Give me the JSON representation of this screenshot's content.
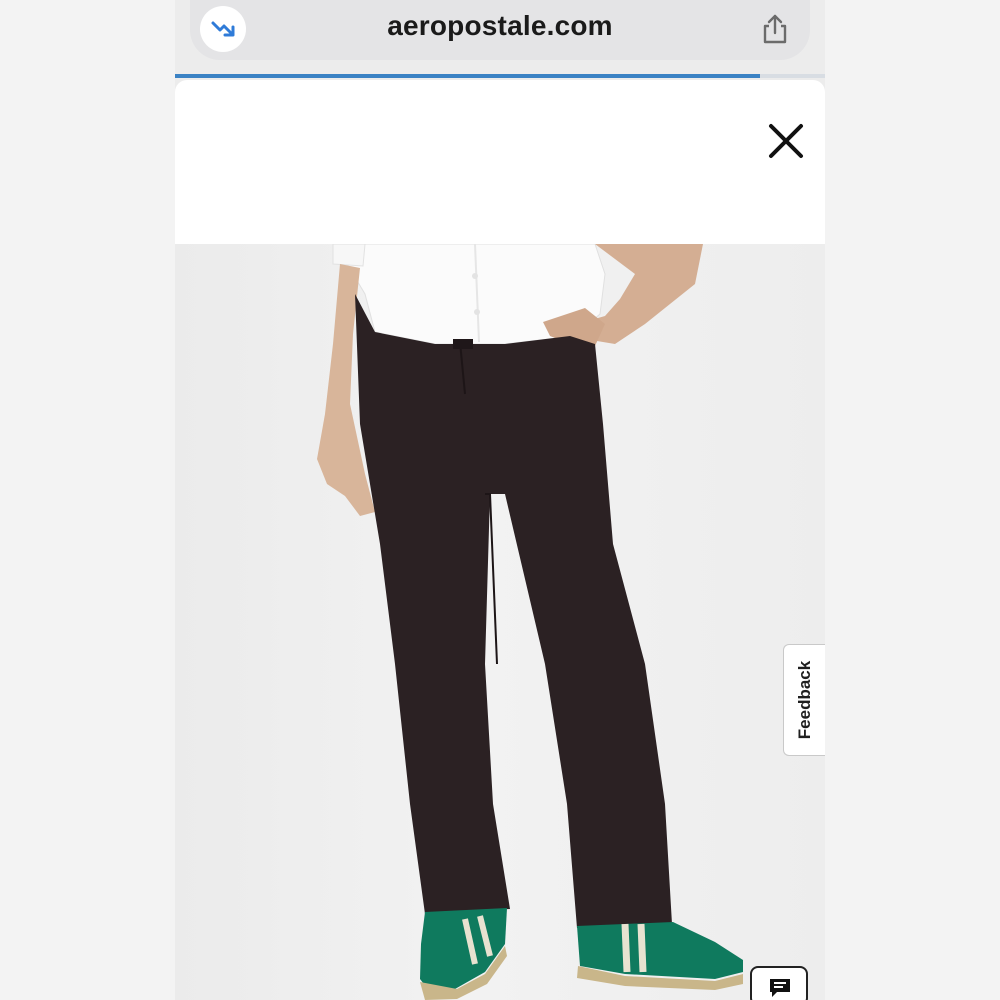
{
  "browser": {
    "url": "aeropostale.com",
    "load_progress_percent": 90
  },
  "feedback": {
    "label": "Feedback"
  },
  "icons": {
    "reader": "trending-down-icon",
    "share": "share-icon",
    "close": "close-icon",
    "chat": "chat-icon"
  },
  "colors": {
    "accent": "#3b82c4",
    "url_bar_bg": "#e4e4e6",
    "pants": "#2b2123",
    "sneakers": "#0f7a5e"
  }
}
